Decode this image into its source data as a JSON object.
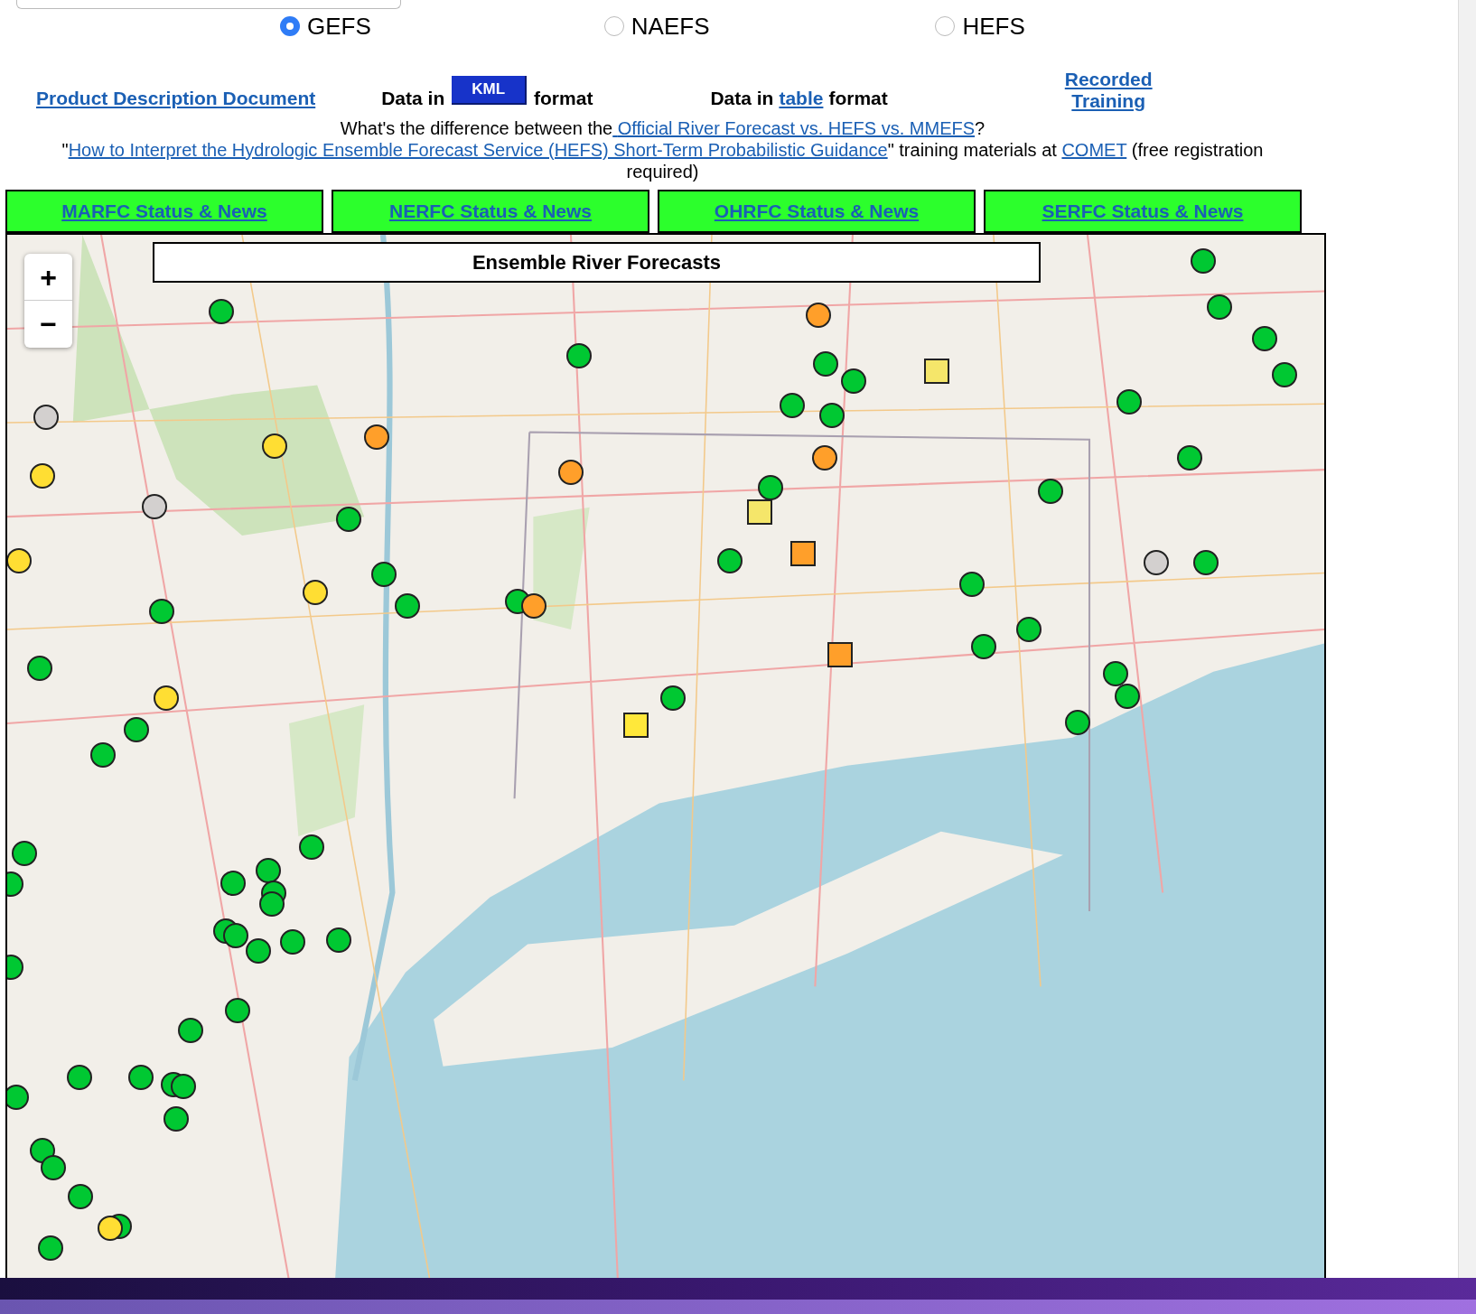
{
  "models": [
    {
      "label": "GEFS",
      "selected": true
    },
    {
      "label": "NAEFS",
      "selected": false
    },
    {
      "label": "HEFS",
      "selected": false
    }
  ],
  "links_row": {
    "product_doc": "Product Description Document",
    "kml_prefix": "Data in",
    "kml_button": "KML",
    "kml_suffix": "format",
    "table_prefix": "Data in",
    "table_link": "table",
    "table_suffix": "format",
    "training_line1": "Recorded",
    "training_line2": "Training"
  },
  "difference_line": {
    "text": "What's the difference between the",
    "link": "Official River Forecast vs. HEFS vs. MMEFS",
    "end": "?"
  },
  "comet_line": {
    "quote_open": "\"",
    "link": "How to Interpret the Hydrologic Ensemble Forecast Service (HEFS) Short-Term Probabilistic Guidance",
    "middle": "\" training materials at",
    "comet_link": "COMET",
    "end": "(free registration required)"
  },
  "rfc_buttons": [
    "MARFC Status & News",
    "NERFC Status & News",
    "OHRFC Status & News",
    "SERFC Status & News"
  ],
  "map": {
    "title": "Ensemble River Forecasts",
    "zoom_in": "+",
    "zoom_out": "−",
    "markers": [
      {
        "kind": "circle",
        "color": "#00c832"
      },
      {
        "kind": "circle",
        "color": "#00c832"
      },
      {
        "kind": "circle",
        "color": "#ff9f2a"
      },
      {
        "kind": "circle",
        "color": "#00c832"
      },
      {
        "kind": "circle",
        "color": "#00c832"
      },
      {
        "kind": "circle",
        "color": "#00c832"
      },
      {
        "kind": "circle",
        "color": "#00c832"
      },
      {
        "kind": "square",
        "color": "#f5e66a"
      },
      {
        "kind": "circle",
        "color": "#d3d0cf"
      },
      {
        "kind": "circle",
        "color": "#ffde33"
      },
      {
        "kind": "circle",
        "color": "#ff9f2a"
      },
      {
        "kind": "circle",
        "color": "#ffde33"
      },
      {
        "kind": "circle",
        "color": "#ff9f2a"
      },
      {
        "kind": "circle",
        "color": "#ff9f2a"
      },
      {
        "kind": "circle",
        "color": "#00c832"
      },
      {
        "kind": "square",
        "color": "#f5e66a"
      },
      {
        "kind": "circle",
        "color": "#d3d0cf"
      },
      {
        "kind": "circle",
        "color": "#00c832"
      },
      {
        "kind": "circle",
        "color": "#ffde33"
      },
      {
        "kind": "circle",
        "color": "#00c832"
      },
      {
        "kind": "square",
        "color": "#ff9f2a"
      },
      {
        "kind": "circle",
        "color": "#ffde33"
      },
      {
        "kind": "circle",
        "color": "#00c832"
      },
      {
        "kind": "circle",
        "color": "#00c832"
      },
      {
        "kind": "circle",
        "color": "#00c832"
      },
      {
        "kind": "circle",
        "color": "#ff9f2a"
      },
      {
        "kind": "circle",
        "color": "#00c832"
      },
      {
        "kind": "square",
        "color": "#ff9f2a"
      },
      {
        "kind": "circle",
        "color": "#00c832"
      },
      {
        "kind": "circle",
        "color": "#ffde33"
      },
      {
        "kind": "circle",
        "color": "#00c832"
      },
      {
        "kind": "square",
        "color": "#ffe83a"
      },
      {
        "kind": "circle",
        "color": "#00c832"
      },
      {
        "kind": "circle",
        "color": "#00c832"
      },
      {
        "kind": "circle",
        "color": "#00c832"
      },
      {
        "kind": "circle",
        "color": "#00c832"
      },
      {
        "kind": "circle",
        "color": "#00c832"
      },
      {
        "kind": "circle",
        "color": "#00c832"
      },
      {
        "kind": "circle",
        "color": "#00c832"
      },
      {
        "kind": "circle",
        "color": "#00c832"
      },
      {
        "kind": "circle",
        "color": "#00c832"
      },
      {
        "kind": "circle",
        "color": "#d3d0cf"
      },
      {
        "kind": "circle",
        "color": "#00c832"
      },
      {
        "kind": "circle",
        "color": "#00c832"
      },
      {
        "kind": "circle",
        "color": "#00c832"
      },
      {
        "kind": "circle",
        "color": "#00c832"
      },
      {
        "kind": "circle",
        "color": "#00c832"
      },
      {
        "kind": "circle",
        "color": "#00c832"
      },
      {
        "kind": "circle",
        "color": "#00c832"
      },
      {
        "kind": "circle",
        "color": "#00c832"
      },
      {
        "kind": "circle",
        "color": "#00c832"
      },
      {
        "kind": "circle",
        "color": "#00c832"
      },
      {
        "kind": "circle",
        "color": "#00c832"
      },
      {
        "kind": "circle",
        "color": "#00c832"
      },
      {
        "kind": "circle",
        "color": "#00c832"
      },
      {
        "kind": "circle",
        "color": "#00c832"
      },
      {
        "kind": "circle",
        "color": "#00c832"
      },
      {
        "kind": "circle",
        "color": "#00c832"
      },
      {
        "kind": "circle",
        "color": "#00c832"
      },
      {
        "kind": "circle",
        "color": "#00c832"
      },
      {
        "kind": "circle",
        "color": "#00c832"
      },
      {
        "kind": "circle",
        "color": "#00c832"
      },
      {
        "kind": "circle",
        "color": "#00c832"
      },
      {
        "kind": "circle",
        "color": "#00c832"
      },
      {
        "kind": "circle",
        "color": "#00c832"
      },
      {
        "kind": "circle",
        "color": "#00c832"
      },
      {
        "kind": "circle",
        "color": "#00c832"
      },
      {
        "kind": "circle",
        "color": "#00c832"
      },
      {
        "kind": "circle",
        "color": "#00c832"
      },
      {
        "kind": "circle",
        "color": "#00c832"
      },
      {
        "kind": "circle",
        "color": "#00c832"
      },
      {
        "kind": "circle",
        "color": "#00c832"
      },
      {
        "kind": "circle",
        "color": "#ffde33"
      },
      {
        "kind": "circle",
        "color": "#00c832"
      },
      {
        "kind": "circle",
        "color": "#00c832"
      },
      {
        "kind": "circle",
        "color": "#00c832"
      }
    ]
  }
}
